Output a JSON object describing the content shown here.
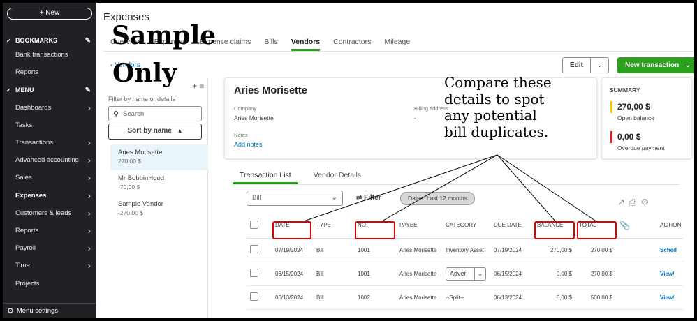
{
  "sidebar": {
    "new_label": "+ New",
    "bookmarks_label": "BOOKMARKS",
    "bookmarks_items": [
      "Bank transactions",
      "Reports"
    ],
    "menu_label": "MENU",
    "menu_items": [
      {
        "label": "Dashboards",
        "arrow": true
      },
      {
        "label": "Tasks",
        "arrow": false
      },
      {
        "label": "Transactions",
        "arrow": true
      },
      {
        "label": "Advanced accounting",
        "arrow": true
      },
      {
        "label": "Sales",
        "arrow": true
      },
      {
        "label": "Expenses",
        "arrow": true,
        "active": true
      },
      {
        "label": "Customers & leads",
        "arrow": true
      },
      {
        "label": "Reports",
        "arrow": true
      },
      {
        "label": "Payroll",
        "arrow": true
      },
      {
        "label": "Time",
        "arrow": true
      },
      {
        "label": "Projects",
        "arrow": false
      }
    ],
    "menu_settings": "Menu settings"
  },
  "header": {
    "title": "Expenses",
    "tabs": [
      "Overview",
      "Expenses",
      "Expense claims",
      "Bills",
      "Vendors",
      "Contractors",
      "Mileage"
    ],
    "active_tab": "Vendors",
    "back_link": "Vendors",
    "edit_label": "Edit",
    "new_transaction_label": "New transaction"
  },
  "overlay": {
    "sample_line1": "Sample",
    "sample_line2": "Only",
    "annotation_lines": [
      "Compare these",
      "details to spot",
      "any potential",
      "bill duplicates."
    ]
  },
  "vendor_list": {
    "filter_label": "Filter by name or details",
    "search_placeholder": "Search",
    "sort_label": "Sort by name",
    "vendors": [
      {
        "name": "Aries Morisette",
        "balance": "270,00 $",
        "selected": true
      },
      {
        "name": "Mr BobbinHood",
        "balance": "-70,00 $"
      },
      {
        "name": "Sample Vendor",
        "balance": "-270,00 $"
      }
    ]
  },
  "vendor_detail": {
    "name": "Aries Morisette",
    "company_label": "Company",
    "company_value": "Aries Morisette",
    "billing_label": "Billing address",
    "billing_value": "-",
    "notes_label": "Notes",
    "add_notes": "Add notes"
  },
  "summary": {
    "title": "SUMMARY",
    "open_balance_value": "270,00 $",
    "open_balance_label": "Open balance",
    "overdue_value": "0,00 $",
    "overdue_label": "Overdue payment",
    "colors": {
      "open": "#f2c300",
      "overdue": "#e02020"
    }
  },
  "transactions": {
    "tabs": [
      "Transaction List",
      "Vendor Details"
    ],
    "type_filter": "Bill",
    "filter_label": "Filter",
    "dates_pill": "Dates: Last 12 months",
    "columns": [
      "",
      "DATE",
      "TYPE",
      "NO.",
      "PAYEE",
      "CATEGORY",
      "DUE DATE",
      "BALANCE",
      "TOTAL",
      "",
      "ACTION"
    ],
    "rows": [
      {
        "date": "07/19/2024",
        "type": "Bill",
        "no": "1001",
        "payee": "Aries Morisette",
        "category": "Inventory Asset",
        "category_select": false,
        "due": "07/19/2024",
        "balance": "270,00 $",
        "total": "270,00 $",
        "action": "Sched"
      },
      {
        "date": "06/15/2024",
        "type": "Bill",
        "no": "1001",
        "payee": "Aries Morisette",
        "category": "Adver",
        "category_select": true,
        "due": "06/15/2024",
        "balance": "0,00 $",
        "total": "270,00 $",
        "action": "View/"
      },
      {
        "date": "06/13/2024",
        "type": "Bill",
        "no": "1002",
        "payee": "Aries Morisette",
        "category": "--Split--",
        "category_select": false,
        "due": "06/13/2024",
        "balance": "0,00 $",
        "total": "500,00 $",
        "action": "View/"
      }
    ]
  },
  "colors": {
    "accent": "#2ca01c",
    "link": "#0077c5",
    "annotation_red": "#e00000",
    "sidebar": "#202124"
  }
}
